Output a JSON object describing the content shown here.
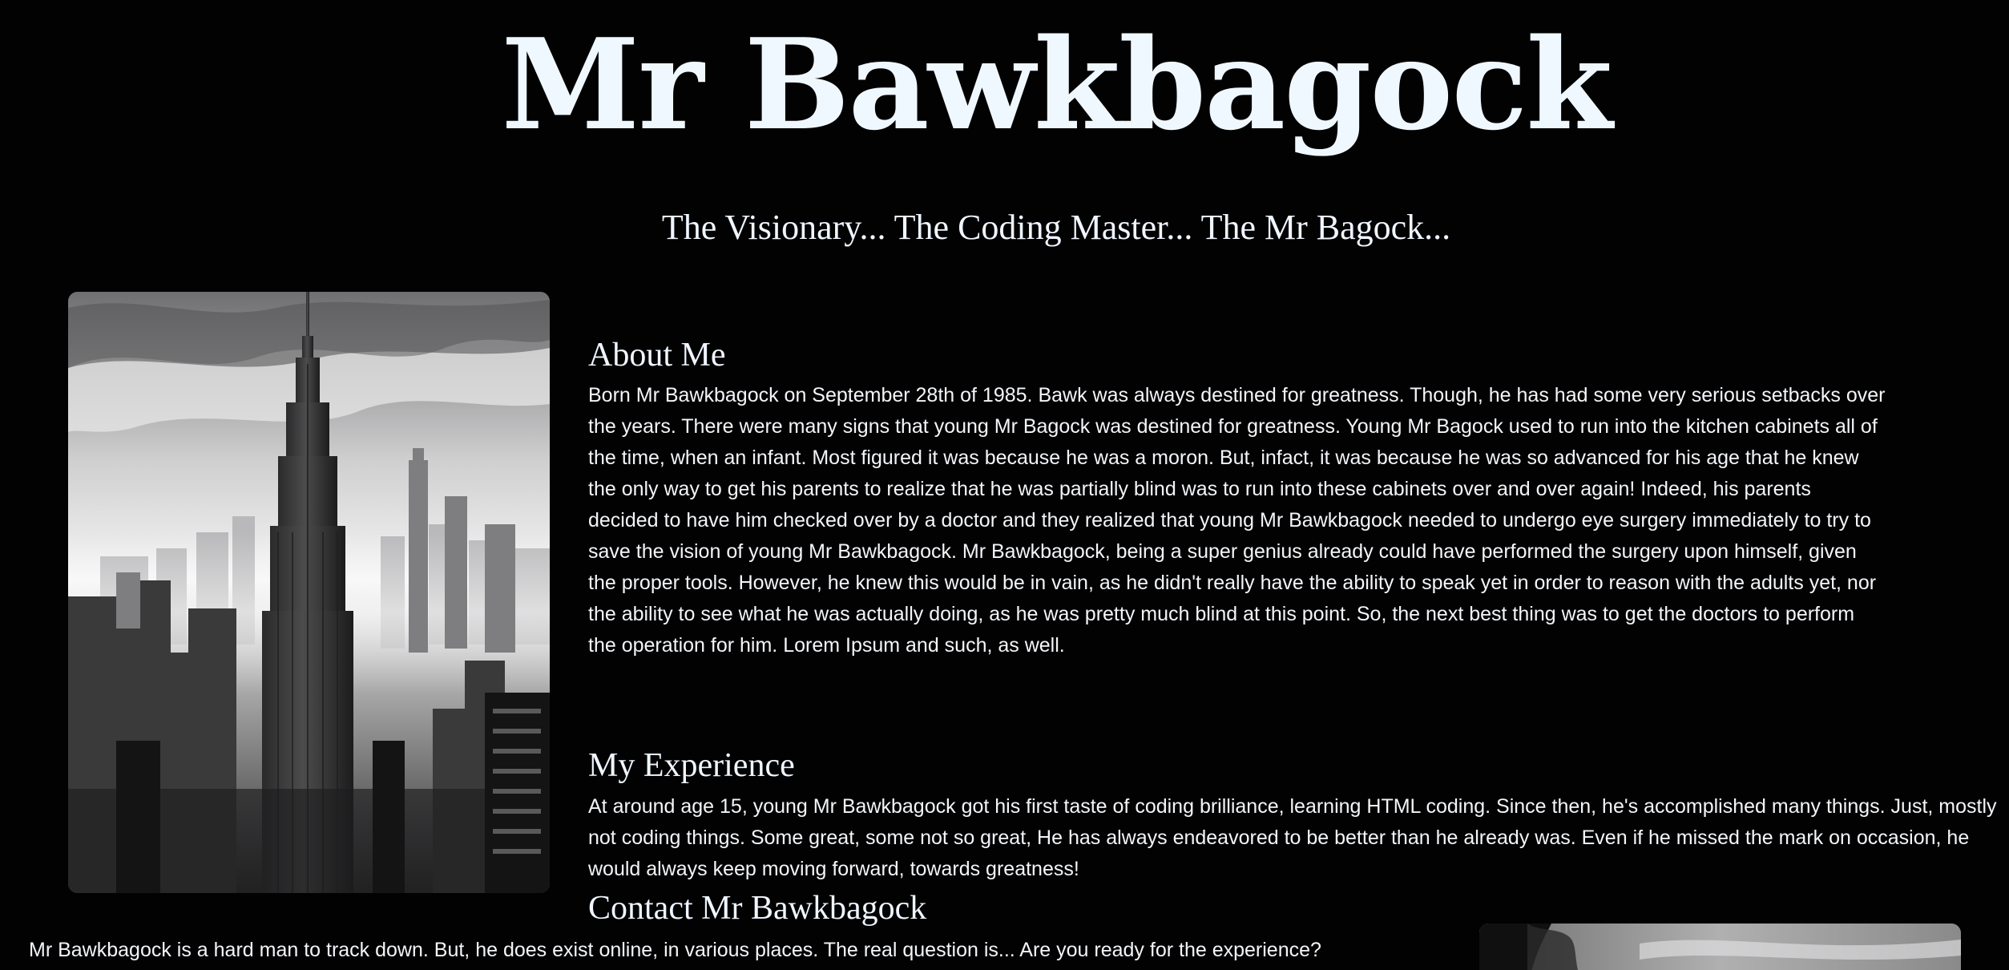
{
  "header": {
    "title": "Mr Bawkbagock",
    "tagline": "The Visionary... The Coding Master... The Mr Bagock..."
  },
  "images": {
    "main": "black-and-white city skyline photo",
    "secondary": "black-and-white landscape photo"
  },
  "about": {
    "heading": "About Me",
    "text": "Born Mr Bawkbagock on September 28th of 1985. Bawk was always destined for greatness. Though, he has had some very serious setbacks over the years. There were many signs that young Mr Bagock was destined for greatness. Young Mr Bagock used to run into the kitchen cabinets all of the time, when an infant. Most figured it was because he was a moron. But, infact, it was because he was so advanced for his age that he knew the only way to get his parents to realize that he was partially blind was to run into these cabinets over and over again! Indeed, his parents decided to have him checked over by a doctor and they realized that young Mr Bawkbagock needed to undergo eye surgery immediately to try to save the vision of young Mr Bawkbagock. Mr Bawkbagock, being a super genius already could have performed the surgery upon himself, given the proper tools. However, he knew this would be in vain, as he didn't really have the ability to speak yet in order to reason with the adults yet, nor the ability to see what he was actually doing, as he was pretty much blind at this point. So, the next best thing was to get the doctors to perform the operation for him. Lorem Ipsum and such, as well."
  },
  "experience": {
    "heading": "My Experience",
    "text": "At around age 15, young Mr Bawkbagock got his first taste of coding brilliance, learning HTML coding. Since then, he's accomplished many things. Just, mostly not coding things. Some great, some not so great, He has always endeavored to be better than he already was. Even if he missed the mark on occasion, he would always keep moving forward, towards greatness!"
  },
  "contact": {
    "heading": "Contact Mr Bawkbagock",
    "text": "Mr Bawkbagock is a hard man to track down. But, he does exist online, in various places. The real question is... Are you ready for the experience?"
  },
  "colors": {
    "background": "#020203",
    "text": "#f2f6fb"
  }
}
